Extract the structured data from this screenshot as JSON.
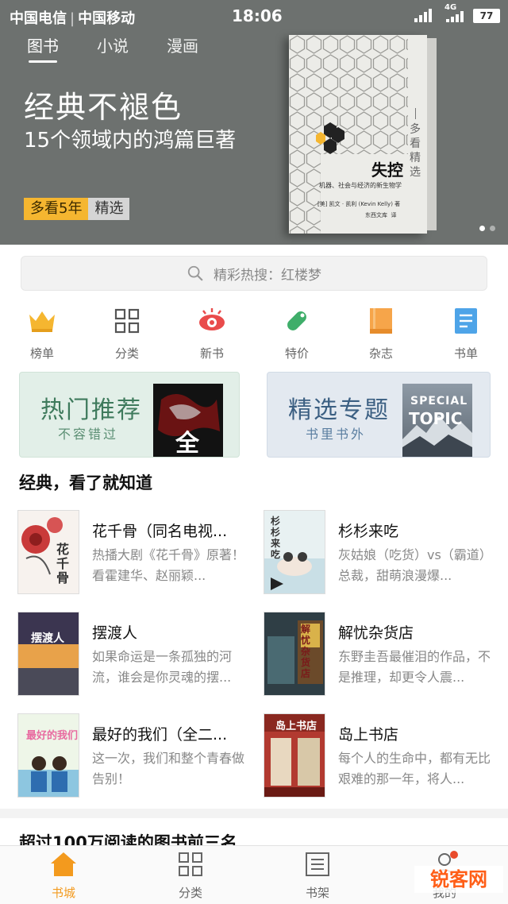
{
  "status_bar": {
    "carrier1": "中国电信",
    "carrier2": "中国移动",
    "time": "18:06",
    "network": "4G",
    "battery": "77"
  },
  "tabs": [
    {
      "label": "图书",
      "active": true
    },
    {
      "label": "小说",
      "active": false
    },
    {
      "label": "漫画",
      "active": false
    }
  ],
  "banner": {
    "title": "经典不褪色",
    "subtitle": "15个领域内的鸿篇巨著",
    "badge_primary": "多看5年",
    "badge_secondary": "精选",
    "book": {
      "vertical_text": "多看精选",
      "title": "失控",
      "subtitle": "机器、社会与经济的新生物学",
      "author": "[美] 凯文 · 凯利 (Kevin Kelly) 著",
      "publisher": "东西文库",
      "translator": "译"
    },
    "page_count": 2,
    "current_page": 1
  },
  "search": {
    "placeholder": "精彩热搜：红楼梦"
  },
  "categories": [
    {
      "label": "榜单",
      "icon": "crown-icon",
      "color": "#f5b630"
    },
    {
      "label": "分类",
      "icon": "grid-icon",
      "color": "#555555"
    },
    {
      "label": "新书",
      "icon": "eye-icon",
      "color": "#e94b4b"
    },
    {
      "label": "特价",
      "icon": "price-tag-icon",
      "color": "#3fae6a"
    },
    {
      "label": "杂志",
      "icon": "magazine-icon",
      "color": "#f6a54a"
    },
    {
      "label": "书单",
      "icon": "booklist-icon",
      "color": "#4ea4e8"
    }
  ],
  "promos": [
    {
      "title": "热门推荐",
      "subtitle": "不容错过",
      "cover_text": "全"
    },
    {
      "title": "精选专题",
      "subtitle": "书里书外",
      "cover_text_1": "SPECIAL",
      "cover_text_2": "TOPIC"
    }
  ],
  "section": {
    "title": "经典，看了就知道",
    "books": [
      {
        "title": "花千骨（同名电视...",
        "desc": "热播大剧《花千骨》原著！看霍建华、赵丽颖...",
        "cover_text": "花千骨",
        "cover_color": "#c93a3a"
      },
      {
        "title": "杉杉来吃",
        "desc": "灰姑娘（吃货）vs（霸道）总裁，甜萌浪漫爆...",
        "cover_text": "杉杉来吃",
        "cover_color": "#7fb2c6"
      },
      {
        "title": "摆渡人",
        "desc": "如果命运是一条孤独的河流，谁会是你灵魂的摆...",
        "cover_text": "摆渡人",
        "cover_color": "#2e2a3a"
      },
      {
        "title": "解忧杂货店",
        "desc": "东野圭吾最催泪的作品，不是推理，却更令人震...",
        "cover_text": "解忧杂货店",
        "cover_color": "#2f3e45"
      },
      {
        "title": "最好的我们（全二...",
        "desc": "这一次，我们和整个青春做告别！",
        "cover_text": "最好的我们",
        "cover_color": "#8dc6e0"
      },
      {
        "title": "岛上书店",
        "desc": "每个人的生命中，都有无比艰难的那一年，将人...",
        "cover_text": "岛上书店",
        "cover_color": "#b23a30"
      }
    ]
  },
  "section2": {
    "title": "超过100万阅读的图书前三名"
  },
  "bottom_nav": [
    {
      "label": "书城",
      "icon": "home-icon",
      "active": true
    },
    {
      "label": "分类",
      "icon": "grid-icon",
      "active": false
    },
    {
      "label": "书架",
      "icon": "bookshelf-icon",
      "active": false
    },
    {
      "label": "我的",
      "icon": "user-icon",
      "active": false
    }
  ],
  "watermark": "锐客网",
  "colors": {
    "accent": "#f39a1e",
    "banner_bg": "#6d716f",
    "badge": "#f5b630"
  }
}
